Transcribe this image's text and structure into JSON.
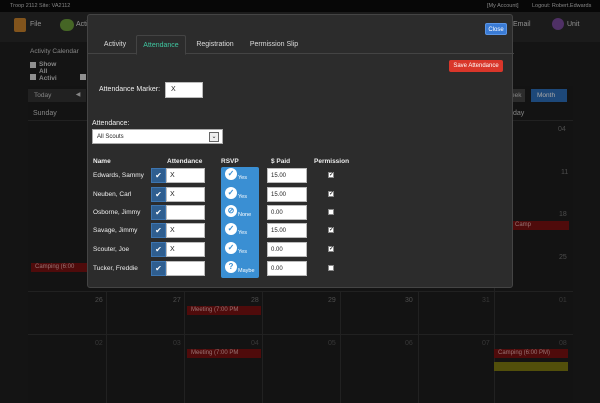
{
  "topbar": {
    "org": "Troop 2112  Site: VA2112",
    "account": "[My Account]",
    "logout": "Logout: Robert.Edwards"
  },
  "nav": {
    "file": "File",
    "activities": "Acti",
    "email": "Email",
    "unit": "Unit"
  },
  "background": {
    "breadcrumb": "Activity Calendar",
    "show_all": "Show All Activi",
    "today": "Today",
    "week": "eek",
    "month": "Month",
    "sunday": "Sunday",
    "saturday": "day",
    "days": [
      "04",
      "11",
      "18",
      "25",
      "26",
      "27",
      "28",
      "29",
      "30",
      "31",
      "01",
      "02",
      "03",
      "04",
      "05",
      "06",
      "07",
      "08",
      "09"
    ],
    "events": {
      "camping1": "Camping (6:00 PM)",
      "camping_left": "Camping (6:00",
      "camp2": "Camp",
      "meeting1": "Meeting (7:00 PM",
      "meeting2": "Meeting (7:00 PM",
      "camping3": "Camping (6:00 PM)"
    }
  },
  "modal": {
    "close_label": "Close",
    "tabs": [
      "Activity",
      "Attendance",
      "Registration",
      "Permission Slip"
    ],
    "active_tab": "Attendance",
    "save_label": "Save Attendance",
    "marker_label": "Attendance Marker:",
    "marker_value": "X",
    "attendance_label": "Attendance:",
    "attendance_selected": "All Scouts",
    "columns": {
      "name": "Name",
      "attendance": "Attendance",
      "rsvp": "RSVP",
      "paid": "$ Paid",
      "permission": "Permission"
    },
    "rows": [
      {
        "name": "Edwards, Sammy",
        "attendance": "X",
        "rsvp": "Yes",
        "rsvp_icon": "check-icon",
        "paid": "15.00",
        "permission": true
      },
      {
        "name": "Neuben, Carl",
        "attendance": "X",
        "rsvp": "Yes",
        "rsvp_icon": "check-icon",
        "paid": "15.00",
        "permission": true
      },
      {
        "name": "Osborne, Jimmy",
        "attendance": "",
        "rsvp": "None",
        "rsvp_icon": "none-icon",
        "paid": "0.00",
        "permission": false
      },
      {
        "name": "Savage, Jimmy",
        "attendance": "X",
        "rsvp": "Yes",
        "rsvp_icon": "check-icon",
        "paid": "15.00",
        "permission": true
      },
      {
        "name": "Scouter, Joe",
        "attendance": "X",
        "rsvp": "Yes",
        "rsvp_icon": "check-icon",
        "paid": "0.00",
        "permission": true
      },
      {
        "name": "Tucker, Freddie",
        "attendance": "",
        "rsvp": "Maybe",
        "rsvp_icon": "question-icon",
        "paid": "0.00",
        "permission": false
      }
    ]
  },
  "colors": {
    "accent": "#3fc6a0",
    "save": "#d9362a",
    "rsvp_bg": "#3a8fd3",
    "checkbox_bg": "#2f5e8f",
    "event_red": "#7a1111",
    "close": "#3a7bd5"
  }
}
